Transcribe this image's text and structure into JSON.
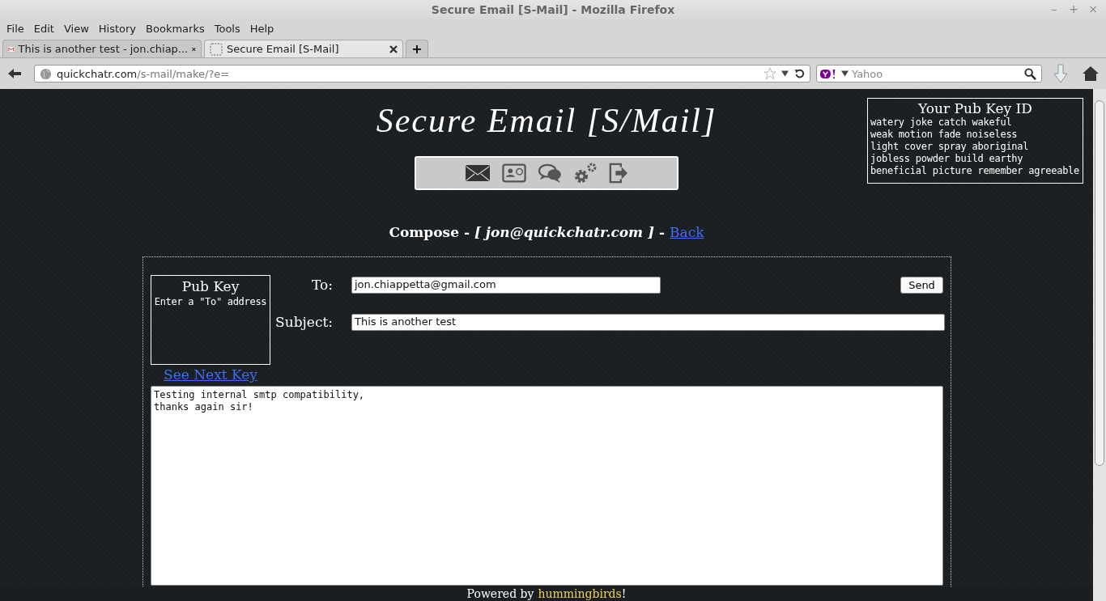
{
  "window": {
    "title": "Secure Email [S-Mail] - Mozilla Firefox",
    "controls": [
      "–",
      "+",
      "×"
    ]
  },
  "menu": [
    "File",
    "Edit",
    "View",
    "History",
    "Bookmarks",
    "Tools",
    "Help"
  ],
  "tabs": [
    {
      "label": "This is another test - jon.chiap...",
      "selected": false,
      "kind": "gmail"
    },
    {
      "label": "Secure Email [S-Mail]",
      "selected": true,
      "kind": "blank"
    }
  ],
  "new_tab": "+",
  "address": {
    "host": "quickchatr.com",
    "path": "/s-mail/make/?e="
  },
  "search": {
    "placeholder": "Yahoo"
  },
  "page": {
    "logo": "Secure Email [S/Mail]",
    "pub_key_id": {
      "title": "Your Pub Key ID",
      "lines": [
        "watery joke catch wakeful",
        "weak motion fade noiseless",
        "light cover spray aboriginal",
        "jobless powder build earthy",
        "beneficial picture remember agreeable"
      ]
    },
    "compose": {
      "heading": "Compose - *[ jon@quickchatr.com ]* -",
      "back": "Back"
    },
    "pub_key": {
      "title": "Pub Key",
      "hint": "Enter a \"To\" address",
      "next": "See Next Key"
    },
    "to": {
      "label": "To:",
      "value": "jon.chiappetta@gmail.com"
    },
    "send": "Send",
    "subject": {
      "label": "Subject:",
      "value": "This is another test"
    },
    "body": [
      "Testing internal smtp compatibility,",
      "thanks again sir!"
    ],
    "footer": {
      "text": "Powered by",
      "link": "hummingbirds",
      "end": "!"
    }
  }
}
